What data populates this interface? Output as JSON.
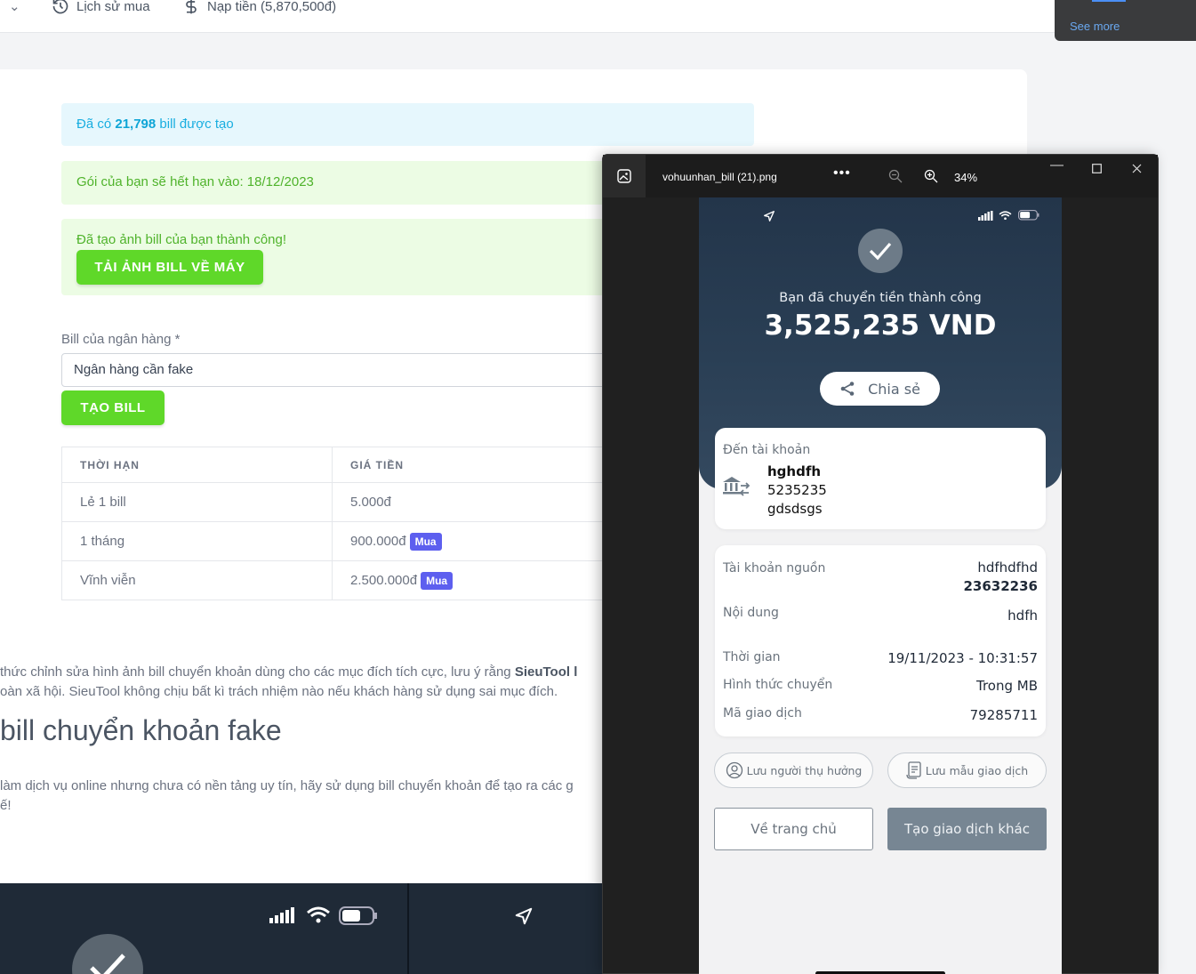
{
  "nav": {
    "history_label": "Lịch sử mua",
    "topup_label": "Nạp tiền (5,870,500đ)"
  },
  "popup": {
    "see_more": "See more"
  },
  "alerts": {
    "info_prefix": "Đã có ",
    "info_count": "21,798",
    "info_suffix": " bill được tạo",
    "expiry": "Gói của bạn sẽ hết hạn vào: 18/12/2023",
    "success": "Đã tạo ảnh bill của bạn thành công!",
    "download_button": "TẢI ẢNH BILL VỀ MÁY"
  },
  "form": {
    "bank_label": "Bill của ngân hàng *",
    "bank_value": "Ngân hàng cần fake",
    "create_button": "TẠO BILL"
  },
  "pricing": {
    "headers": [
      "THỜI HẠN",
      "GIÁ TIỀN"
    ],
    "rows": [
      {
        "duration": "Lẻ 1 bill",
        "price": "5.000đ",
        "buy": ""
      },
      {
        "duration": "1 tháng",
        "price": "900.000đ",
        "buy": "Mua"
      },
      {
        "duration": "Vĩnh viễn",
        "price": "2.500.000đ",
        "buy": "Mua"
      }
    ]
  },
  "content": {
    "line1_a": "thức chỉnh sửa hình ảnh bill chuyển khoản dùng cho các mục đích tích cực, lưu ý rằng ",
    "line1_b": "SieuTool l",
    "line2": "oàn xã hội. SieuTool không chịu bất kì trách nhiệm nào nếu khách hàng sử dụng sai mục đích.",
    "heading": "bill chuyển khoản fake",
    "line3": "làm dịch vụ online nhưng chưa có nền tảng uy tín, hãy sử dụng bill chuyển khoản để tạo ra các g",
    "line4": "ế!"
  },
  "viewer": {
    "filename": "vohuunhan_bill (21).png",
    "zoom": "34%"
  },
  "receipt": {
    "success_text": "Bạn đã chuyển tiền thành công",
    "amount": "3,525,235 VND",
    "share_label": "Chia sẻ",
    "to_account_label": "Đến tài khoản",
    "to_name": "hghdfh",
    "to_number": "5235235",
    "to_bank": "gdsdsgs",
    "source_label": "Tài khoản nguồn",
    "source_name": "hdfhdfhd",
    "source_number": "23632236",
    "content_label": "Nội dung",
    "content_value": "hdfh",
    "time_label": "Thời gian",
    "time_value": "19/11/2023 - 10:31:57",
    "method_label": "Hình thức chuyển",
    "method_value": "Trong MB",
    "txid_label": "Mã giao dịch",
    "txid_value": "79285711",
    "save_beneficiary": "Lưu người thụ hưởng",
    "save_template": "Lưu mẫu giao dịch",
    "home_button": "Về trang chủ",
    "new_tx_button": "Tạo giao dịch khác"
  }
}
